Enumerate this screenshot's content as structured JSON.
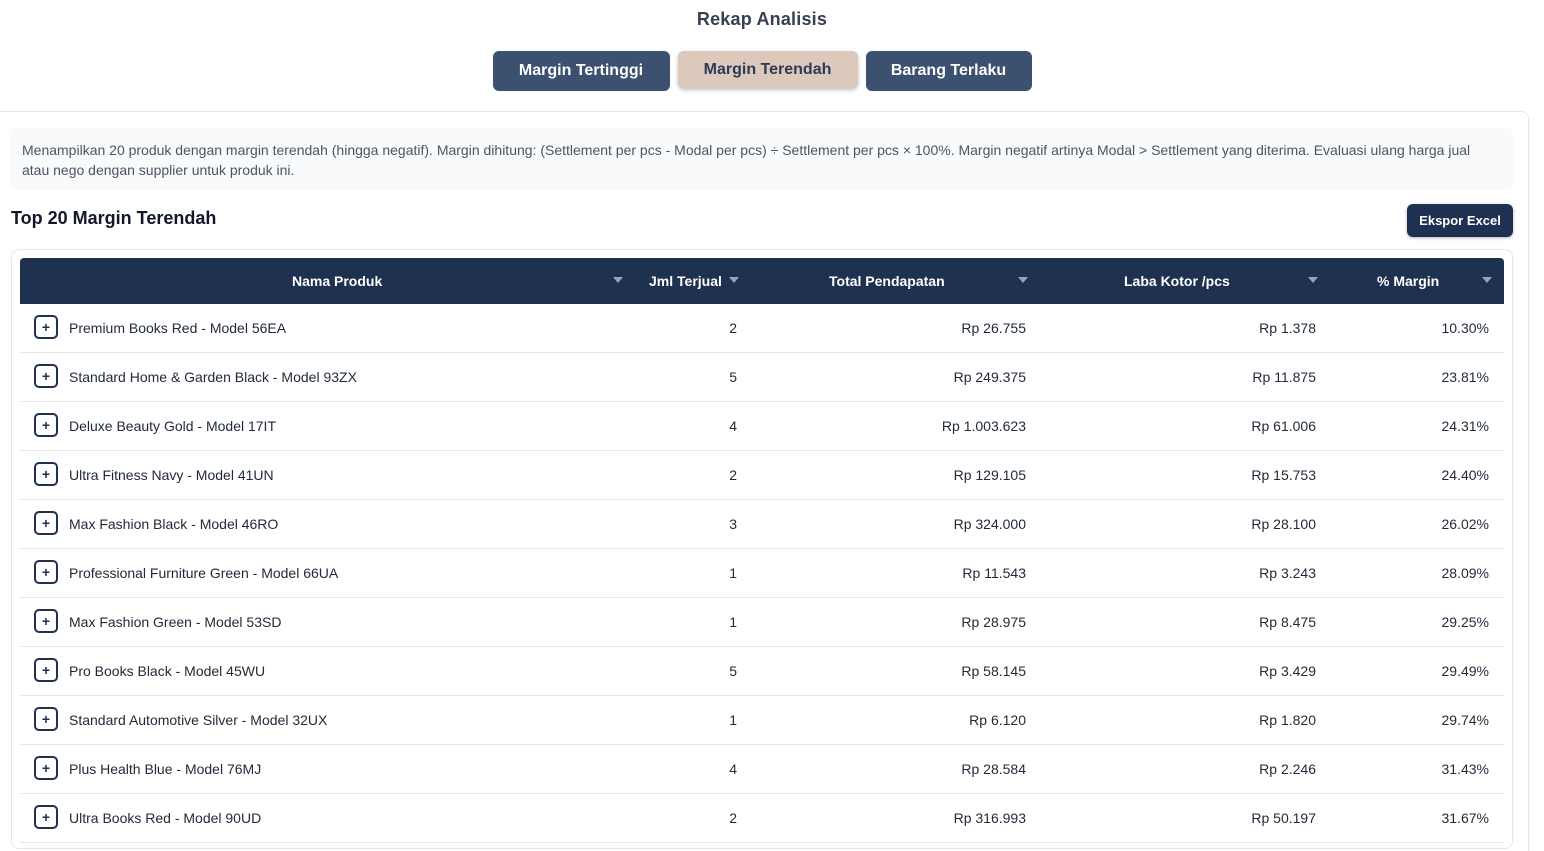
{
  "page_title": "Rekap Analisis",
  "tabs": [
    {
      "label": "Margin Tertinggi",
      "active": false
    },
    {
      "label": "Margin Terendah",
      "active": true
    },
    {
      "label": "Barang Terlaku",
      "active": false
    }
  ],
  "info_text": "Menampilkan 20 produk dengan margin terendah (hingga negatif). Margin dihitung: (Settlement per pcs - Modal per pcs) ÷ Settlement per pcs × 100%. Margin negatif artinya Modal > Settlement yang diterima. Evaluasi ulang harga jual atau nego dengan supplier untuk produk ini.",
  "section_title": "Top 20 Margin Terendah",
  "export_label": "Ekspor Excel",
  "colors": {
    "header_bg": "#1f3150",
    "tab_bg": "#3c5170",
    "active_tab_bg": "#dcc9bb"
  },
  "table": {
    "columns": [
      "Nama Produk",
      "Jml Terjual",
      "Total Pendapatan",
      "Laba Kotor /pcs",
      "% Margin"
    ],
    "expand_label": "+",
    "rows": [
      {
        "name": "Premium Books Red - Model 56EA",
        "qty": "2",
        "revenue": "Rp 26.755",
        "laba": "Rp 1.378",
        "margin": "10.30%"
      },
      {
        "name": "Standard Home & Garden Black - Model 93ZX",
        "qty": "5",
        "revenue": "Rp 249.375",
        "laba": "Rp 11.875",
        "margin": "23.81%"
      },
      {
        "name": "Deluxe Beauty Gold - Model 17IT",
        "qty": "4",
        "revenue": "Rp 1.003.623",
        "laba": "Rp 61.006",
        "margin": "24.31%"
      },
      {
        "name": "Ultra Fitness Navy - Model 41UN",
        "qty": "2",
        "revenue": "Rp 129.105",
        "laba": "Rp 15.753",
        "margin": "24.40%"
      },
      {
        "name": "Max Fashion Black - Model 46RO",
        "qty": "3",
        "revenue": "Rp 324.000",
        "laba": "Rp 28.100",
        "margin": "26.02%"
      },
      {
        "name": "Professional Furniture Green - Model 66UA",
        "qty": "1",
        "revenue": "Rp 11.543",
        "laba": "Rp 3.243",
        "margin": "28.09%"
      },
      {
        "name": "Max Fashion Green - Model 53SD",
        "qty": "1",
        "revenue": "Rp 28.975",
        "laba": "Rp 8.475",
        "margin": "29.25%"
      },
      {
        "name": "Pro Books Black - Model 45WU",
        "qty": "5",
        "revenue": "Rp 58.145",
        "laba": "Rp 3.429",
        "margin": "29.49%"
      },
      {
        "name": "Standard Automotive Silver - Model 32UX",
        "qty": "1",
        "revenue": "Rp 6.120",
        "laba": "Rp 1.820",
        "margin": "29.74%"
      },
      {
        "name": "Plus Health Blue - Model 76MJ",
        "qty": "4",
        "revenue": "Rp 28.584",
        "laba": "Rp 2.246",
        "margin": "31.43%"
      },
      {
        "name": "Ultra Books Red - Model 90UD",
        "qty": "2",
        "revenue": "Rp 316.993",
        "laba": "Rp 50.197",
        "margin": "31.67%"
      }
    ]
  }
}
